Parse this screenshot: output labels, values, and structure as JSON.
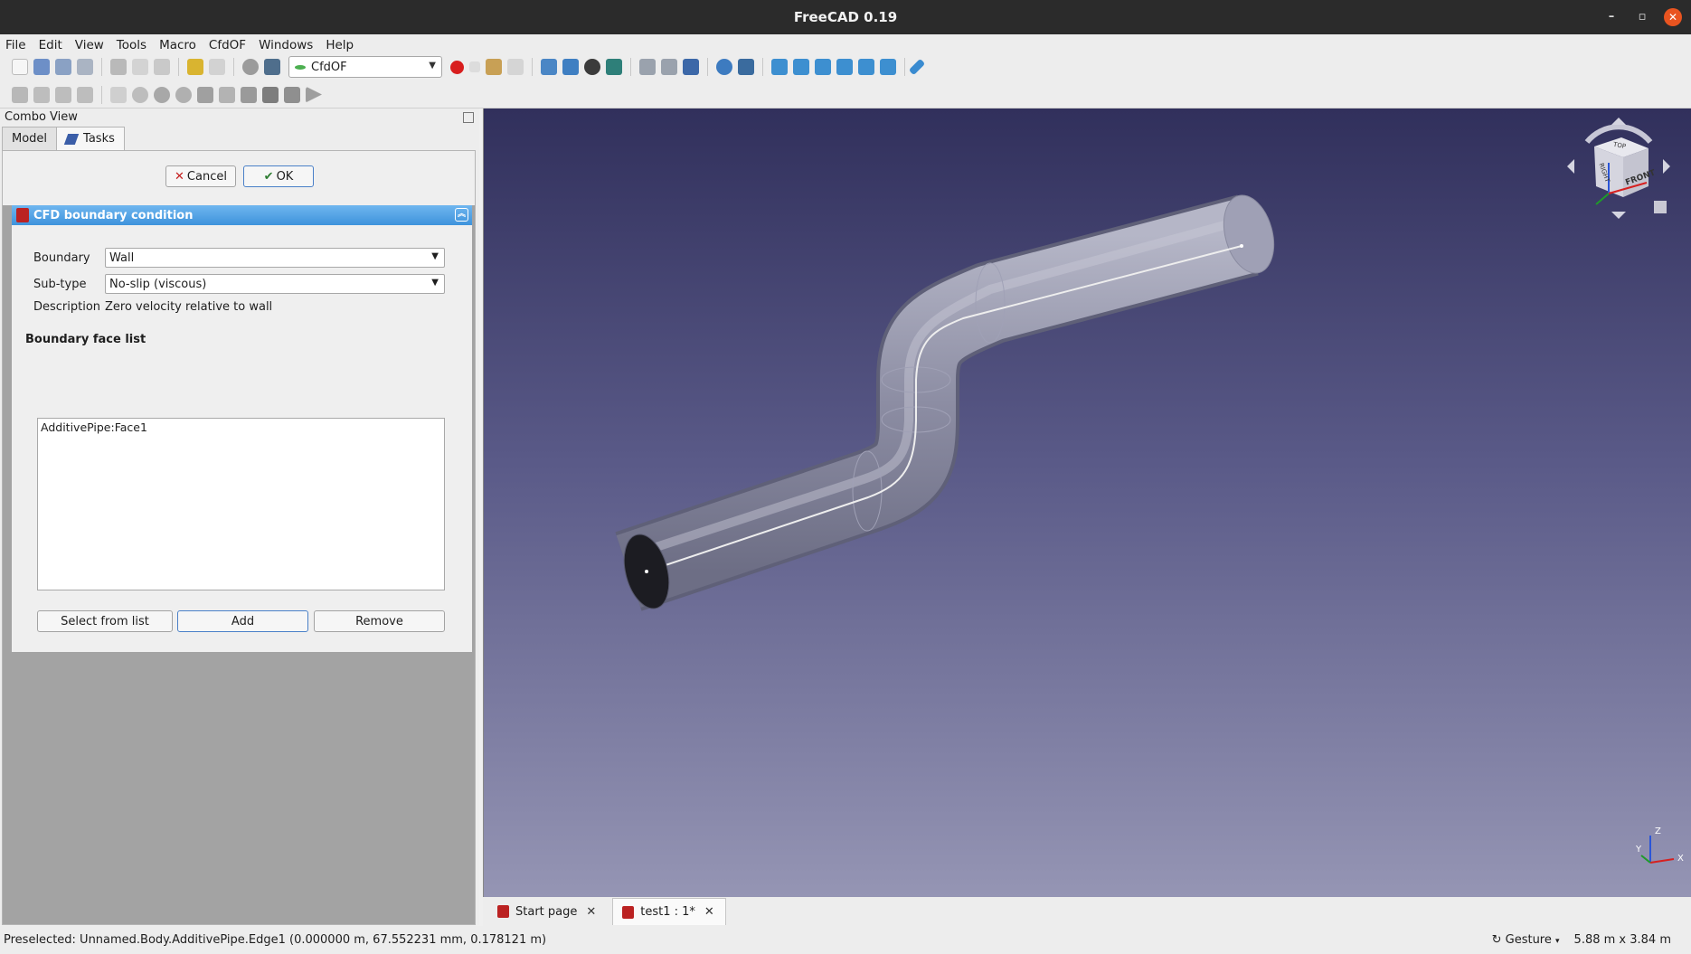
{
  "window": {
    "title": "FreeCAD 0.19"
  },
  "menu": [
    "File",
    "Edit",
    "View",
    "Tools",
    "Macro",
    "CfdOF",
    "Windows",
    "Help"
  ],
  "toolbar": {
    "workbench": "CfdOF"
  },
  "combo_view": {
    "title": "Combo View",
    "tabs": [
      "Model",
      "Tasks"
    ],
    "cancel_label": "Cancel",
    "ok_label": "OK"
  },
  "panel": {
    "title": "CFD boundary condition",
    "boundary_label": "Boundary",
    "boundary_value": "Wall",
    "subtype_label": "Sub-type",
    "subtype_value": "No-slip (viscous)",
    "description_label": "Description",
    "description_value": "Zero velocity relative to wall",
    "face_list_title": "Boundary face list",
    "faces": [
      "AdditivePipe:Face1"
    ],
    "select_label": "Select from list",
    "add_label": "Add",
    "remove_label": "Remove"
  },
  "navcube": {
    "front_label": "FRONT",
    "top_label": "TOP",
    "right_label": "RIGHT"
  },
  "axis_labels": {
    "x": "X",
    "y": "Y",
    "z": "Z"
  },
  "documents": [
    "Start page",
    "test1 : 1*"
  ],
  "status": {
    "message": "Preselected: Unnamed.Body.AdditivePipe.Edge1 (0.000000 m, 67.552231 mm, 0.178121 m)",
    "navigation": "Gesture",
    "dimensions": "5.88 m x 3.84 m"
  },
  "colors": {
    "accent": "#3e93dc",
    "viewport_top": "#31305c",
    "viewport_bottom": "#9595b4",
    "close": "#e95420"
  }
}
